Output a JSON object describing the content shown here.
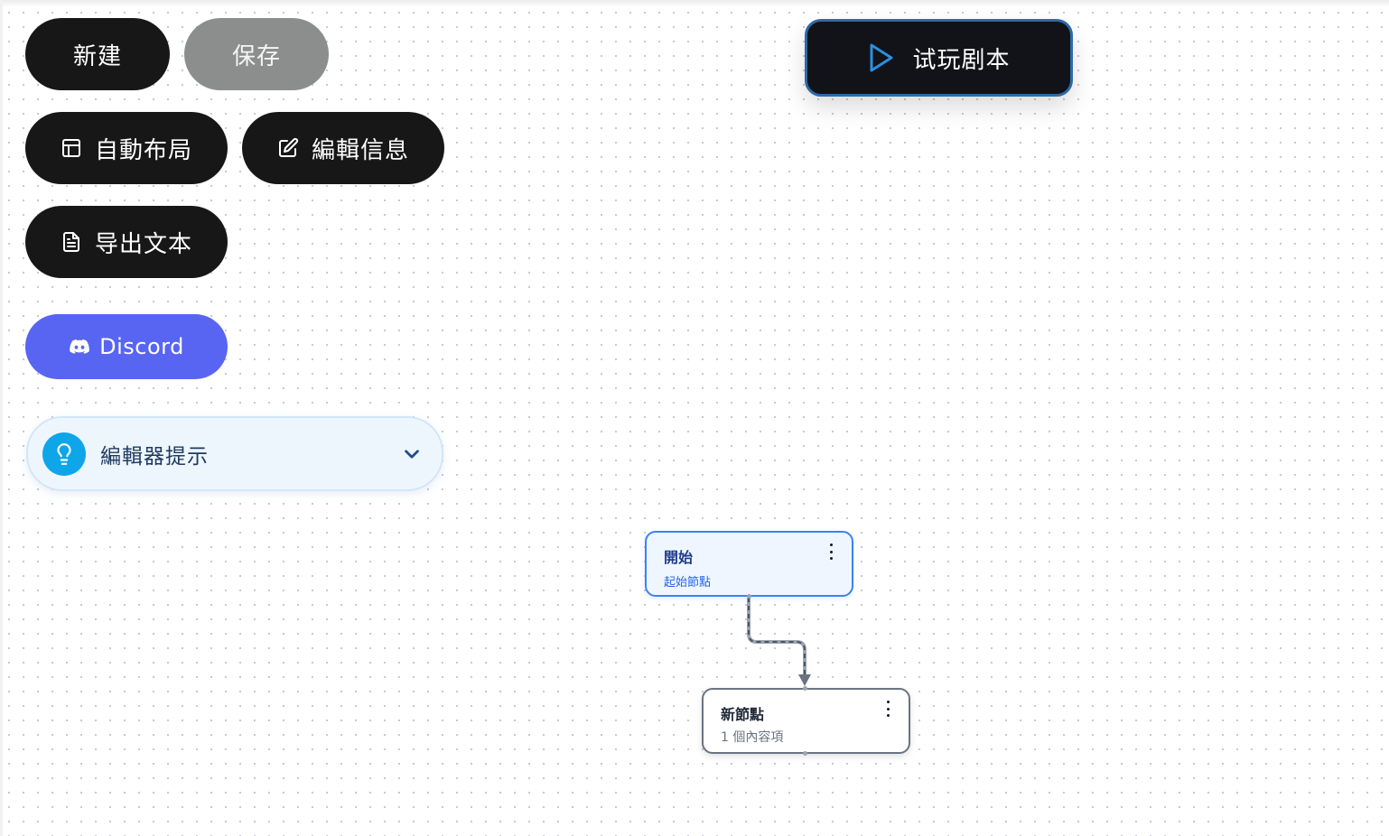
{
  "toolbar": {
    "new_label": "新建",
    "save_label": "保存",
    "auto_layout_label": "自動布局",
    "edit_info_label": "編輯信息",
    "export_text_label": "导出文本",
    "discord_label": "Discord"
  },
  "play_button": {
    "label": "试玩剧本"
  },
  "tips_panel": {
    "label": "編輯器提示",
    "collapsed": true
  },
  "nodes": [
    {
      "title": "開始",
      "subtitle": "起始節點"
    },
    {
      "title": "新節點",
      "subtitle": "1 個內容項"
    }
  ],
  "colors": {
    "button_dark": "#171717",
    "button_disabled": "#8c8e8d",
    "discord": "#5865f2",
    "accent_blue": "#3b82f6",
    "tips_icon": "#0ea5e9"
  }
}
